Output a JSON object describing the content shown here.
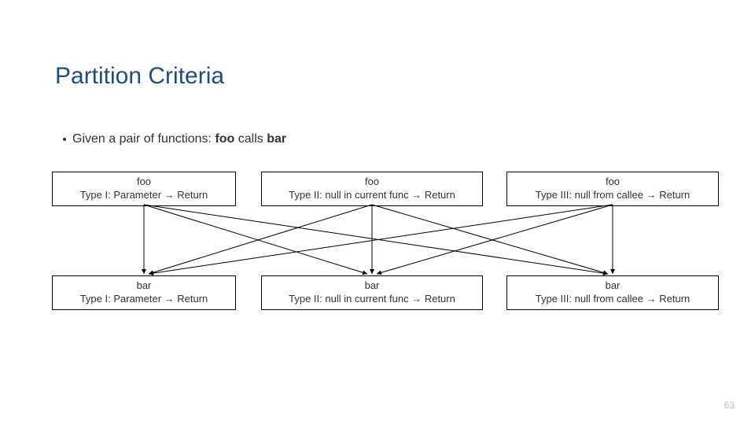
{
  "title": "Partition Criteria",
  "bullet": {
    "prefix": "Given a pair of functions: ",
    "bold1": "foo",
    "mid": " calls ",
    "bold2": "bar"
  },
  "arrow_glyph": "→",
  "nodes": {
    "top": [
      {
        "fn": "foo",
        "desc": "Type I: Parameter → Return"
      },
      {
        "fn": "foo",
        "desc": "Type II: null in current func → Return"
      },
      {
        "fn": "foo",
        "desc": "Type III: null from callee → Return"
      }
    ],
    "bottom": [
      {
        "fn": "bar",
        "desc": "Type I: Parameter → Return"
      },
      {
        "fn": "bar",
        "desc": "Type II: null in current func → Return"
      },
      {
        "fn": "bar",
        "desc": "Type III: null from callee → Return"
      }
    ]
  },
  "page_number": "63",
  "chart_data": {
    "type": "diagram",
    "title": "Partition Criteria",
    "description": "Bipartite mapping: each foo type connects to every bar type (3x3 = 9 directed edges).",
    "top_nodes": [
      "foo Type I",
      "foo Type II",
      "foo Type III"
    ],
    "bottom_nodes": [
      "bar Type I",
      "bar Type II",
      "bar Type III"
    ],
    "edges": [
      [
        "foo Type I",
        "bar Type I"
      ],
      [
        "foo Type I",
        "bar Type II"
      ],
      [
        "foo Type I",
        "bar Type III"
      ],
      [
        "foo Type II",
        "bar Type I"
      ],
      [
        "foo Type II",
        "bar Type II"
      ],
      [
        "foo Type II",
        "bar Type III"
      ],
      [
        "foo Type III",
        "bar Type I"
      ],
      [
        "foo Type III",
        "bar Type II"
      ],
      [
        "foo Type III",
        "bar Type III"
      ]
    ]
  }
}
